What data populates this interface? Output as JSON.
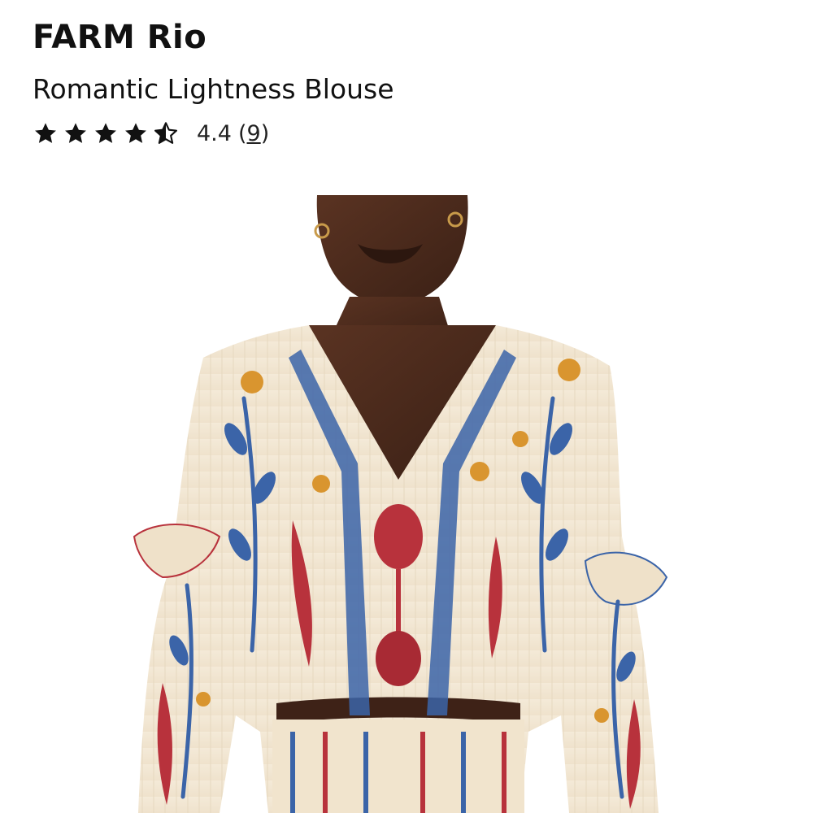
{
  "product": {
    "brand": "FARM Rio",
    "name": "Romantic Lightness Blouse",
    "rating": {
      "value": "4.4",
      "stars": 4.5,
      "open_paren": "(",
      "count": "9",
      "close_paren": ")"
    }
  },
  "icons": {
    "star_full": "star-icon",
    "star_half": "star-half-icon"
  },
  "colors": {
    "text": "#111111",
    "fabric": "#f1e6d2",
    "blue": "#3b64a8",
    "red": "#b8323c",
    "orange": "#d9952f",
    "skin": "#4a2a1c"
  }
}
